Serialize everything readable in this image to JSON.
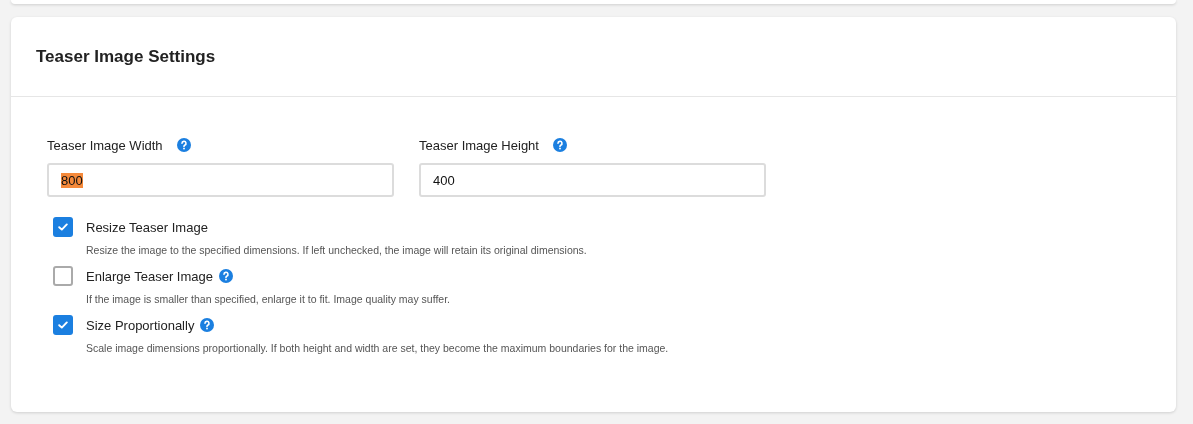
{
  "card": {
    "title": "Teaser Image Settings"
  },
  "fields": [
    {
      "label": "Teaser Image Width",
      "help": true,
      "value": "800",
      "value_selected": true
    },
    {
      "label": "Teaser Image Height",
      "help": true,
      "value": "400",
      "value_selected": false
    }
  ],
  "options": [
    {
      "label": "Resize Teaser Image",
      "help": false,
      "checked": true,
      "description": "Resize the image to the specified dimensions. If left unchecked, the image will retain its original dimensions."
    },
    {
      "label": "Enlarge Teaser Image",
      "help": true,
      "checked": false,
      "description": "If the image is smaller than specified, enlarge it to fit. Image quality may suffer."
    },
    {
      "label": "Size Proportionally",
      "help": true,
      "checked": true,
      "description": "Scale image dimensions proportionally. If both height and width are set, they become the maximum boundaries for the image."
    }
  ]
}
